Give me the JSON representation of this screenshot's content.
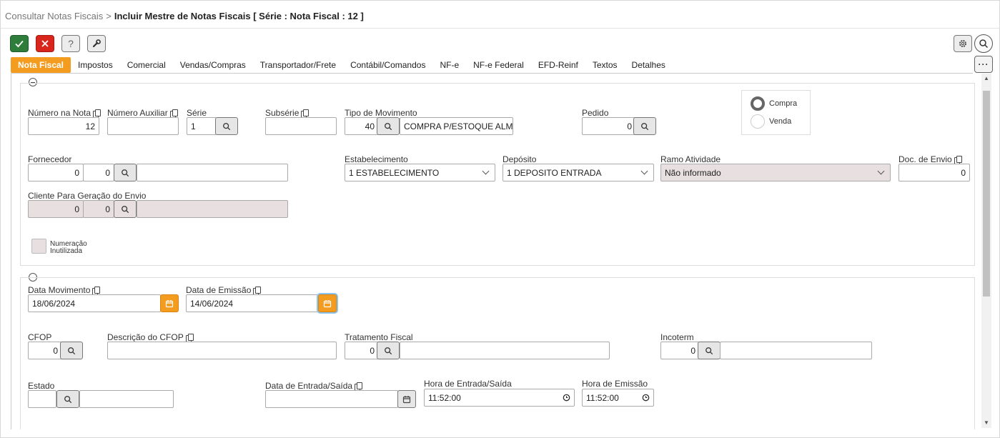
{
  "breadcrumb": {
    "parent": "Consultar Notas Fiscais",
    "separator": ">",
    "current": "Incluir Mestre de Notas Fiscais [ Série : Nota Fiscal : 12 ]"
  },
  "toolbar": {
    "confirm_icon": "check-icon",
    "cancel_icon": "close-icon",
    "help_label": "?",
    "tools_icon": "wrench-icon",
    "settings_icon": "gear-icon",
    "search_icon": "search-icon",
    "more_label": "···"
  },
  "tabs": [
    {
      "label": "Nota Fiscal",
      "active": true
    },
    {
      "label": "Impostos"
    },
    {
      "label": "Comercial"
    },
    {
      "label": "Vendas/Compras"
    },
    {
      "label": "Transportador/Frete"
    },
    {
      "label": "Contábil/Comandos"
    },
    {
      "label": "NF-e"
    },
    {
      "label": "NF-e Federal"
    },
    {
      "label": "EFD-Reinf"
    },
    {
      "label": "Textos"
    },
    {
      "label": "Detalhes"
    }
  ],
  "section1": {
    "numero_nota": {
      "label": "Número na Nota",
      "value": "12"
    },
    "numero_auxiliar": {
      "label": "Número Auxiliar",
      "value": ""
    },
    "serie": {
      "label": "Série",
      "value": "1"
    },
    "subserie": {
      "label": "Subsérie",
      "value": ""
    },
    "tipo_movimento": {
      "label": "Tipo de Movimento",
      "code": "40",
      "description": "COMPRA P/ESTOQUE ALMOX"
    },
    "pedido": {
      "label": "Pedido",
      "value": "0"
    },
    "tipo_operacao": {
      "options": [
        "Compra",
        "Venda"
      ],
      "selected": "Compra"
    },
    "fornecedor": {
      "label": "Fornecedor",
      "code1": "0",
      "code2": "0",
      "name": ""
    },
    "estabelecimento": {
      "label": "Estabelecimento",
      "value": "1 ESTABELECIMENTO"
    },
    "deposito": {
      "label": "Depósito",
      "value": "1 DEPOSITO ENTRADA"
    },
    "ramo_atividade": {
      "label": "Ramo Atividade",
      "value": "Não informado"
    },
    "doc_envio": {
      "label": "Doc. de Envio",
      "value": "0"
    },
    "cliente_envio": {
      "label": "Cliente Para Geração do Envio",
      "code1": "0",
      "code2": "0",
      "name": ""
    },
    "numeracao_inutilizada": {
      "label_line1": "Numeração",
      "label_line2": "Inutilizada",
      "checked": false
    }
  },
  "section2": {
    "data_movimento": {
      "label": "Data Movimento",
      "value": "18/06/2024"
    },
    "data_emissao": {
      "label": "Data de Emissão",
      "value": "14/06/2024"
    },
    "cfop": {
      "label": "CFOP",
      "value": "0"
    },
    "descricao_cfop": {
      "label": "Descrição do CFOP",
      "value": ""
    },
    "tratamento_fiscal": {
      "label": "Tratamento Fiscal",
      "value": "0",
      "description": ""
    },
    "incoterm": {
      "label": "Incoterm",
      "value": "0",
      "description": ""
    },
    "estado": {
      "label": "Estado",
      "value": "",
      "description": ""
    },
    "data_entrada_saida": {
      "label": "Data de Entrada/Saída",
      "value": ""
    },
    "hora_entrada_saida": {
      "label": "Hora de Entrada/Saída",
      "value": "11:52:00"
    },
    "hora_emissao": {
      "label": "Hora de Emissão",
      "value": "11:52:00"
    }
  }
}
